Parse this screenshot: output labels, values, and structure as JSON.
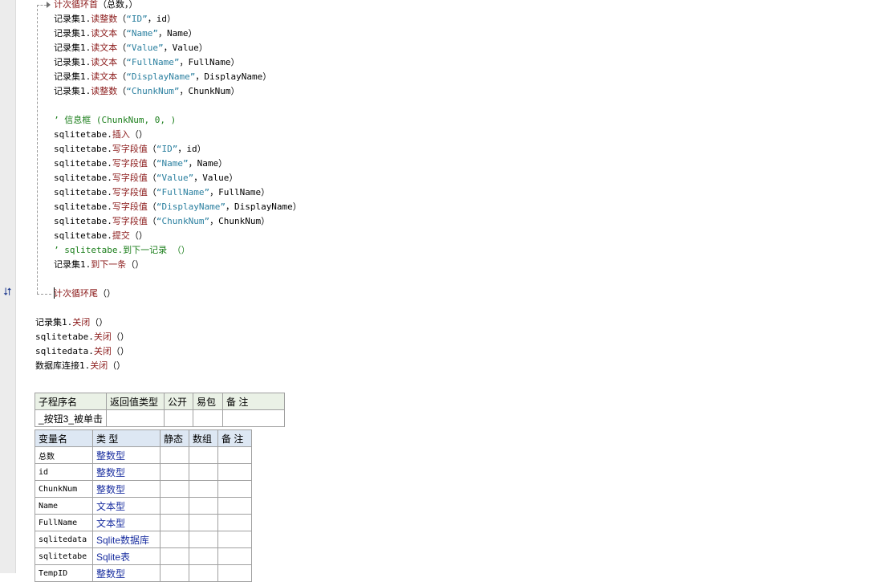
{
  "colors": {
    "keyword": "#8b1a1a",
    "string": "#2a7f9f",
    "comment": "#1c7f1c",
    "type": "#1a2fa0",
    "sub_header_bg": "#eaf1e6",
    "var_header_bg": "#dde7f3"
  },
  "icons": {
    "loop_marker": "loop-arrows-icon"
  },
  "code": {
    "loop_head": {
      "cmd": "计次循环首",
      "args": "（总数，）"
    },
    "rs_reads": [
      {
        "obj": "记录集1.",
        "cmd": "读整数",
        "open": "（",
        "str": "“ID”",
        "rest": "，id）"
      },
      {
        "obj": "记录集1.",
        "cmd": "读文本",
        "open": "（",
        "str": "“Name”",
        "rest": "，Name）"
      },
      {
        "obj": "记录集1.",
        "cmd": "读文本",
        "open": "（",
        "str": "“Value”",
        "rest": "，Value）"
      },
      {
        "obj": "记录集1.",
        "cmd": "读文本",
        "open": "（",
        "str": "“FullName”",
        "rest": "，FullName）"
      },
      {
        "obj": "记录集1.",
        "cmd": "读文本",
        "open": "（",
        "str": "“DisplayName”",
        "rest": "，DisplayName）"
      },
      {
        "obj": "记录集1.",
        "cmd": "读整数",
        "open": "（",
        "str": "“ChunkNum”",
        "rest": "，ChunkNum）"
      }
    ],
    "comment_msgbox": "’ 信息框 (ChunkNum, 0, )",
    "insert": {
      "obj": "sqlitetabe.",
      "cmd": "插入",
      "rest": "（）"
    },
    "writes": [
      {
        "obj": "sqlitetabe.",
        "cmd": "写字段值",
        "open": "（",
        "str": "“ID”",
        "rest": "，id）"
      },
      {
        "obj": "sqlitetabe.",
        "cmd": "写字段值",
        "open": "（",
        "str": "“Name”",
        "rest": "，Name）"
      },
      {
        "obj": "sqlitetabe.",
        "cmd": "写字段值",
        "open": "（",
        "str": "“Value”",
        "rest": "，Value）"
      },
      {
        "obj": "sqlitetabe.",
        "cmd": "写字段值",
        "open": "（",
        "str": "“FullName”",
        "rest": "，FullName）"
      },
      {
        "obj": "sqlitetabe.",
        "cmd": "写字段值",
        "open": "（",
        "str": "“DisplayName”",
        "rest": "，DisplayName）"
      },
      {
        "obj": "sqlitetabe.",
        "cmd": "写字段值",
        "open": "（",
        "str": "“ChunkNum”",
        "rest": "，ChunkNum）"
      }
    ],
    "commit": {
      "obj": "sqlitetabe.",
      "cmd": "提交",
      "rest": "（）"
    },
    "comment_next": "’ sqlitetabe.到下一记录 （）",
    "rs_next": {
      "obj": "记录集1.",
      "cmd": "到下一条",
      "rest": "（）"
    },
    "loop_tail": {
      "cmd": "计次循环尾",
      "rest": "（）"
    },
    "closes": [
      {
        "obj": "记录集1.",
        "cmd": "关闭",
        "rest": "（）"
      },
      {
        "obj": "sqlitetabe.",
        "cmd": "关闭",
        "rest": "（）"
      },
      {
        "obj": "sqlitedata.",
        "cmd": "关闭",
        "rest": "（）"
      },
      {
        "obj": "数据库连接1.",
        "cmd": "关闭",
        "rest": "（）"
      }
    ]
  },
  "sub_table": {
    "headers": [
      "子程序名",
      "返回值类型",
      "公开",
      "易包",
      "备 注"
    ],
    "row": [
      "_按钮3_被单击",
      "",
      "",
      "",
      ""
    ]
  },
  "var_table": {
    "headers": [
      "变量名",
      "类 型",
      "静态",
      "数组",
      "备 注"
    ],
    "rows": [
      [
        "总数",
        "整数型"
      ],
      [
        "id",
        "整数型"
      ],
      [
        "ChunkNum",
        "整数型"
      ],
      [
        "Name",
        "文本型"
      ],
      [
        "FullName",
        "文本型"
      ],
      [
        "sqlitedata",
        "Sqlite数据库"
      ],
      [
        "sqlitetabe",
        "Sqlite表"
      ],
      [
        "TempID",
        "整数型"
      ]
    ]
  }
}
